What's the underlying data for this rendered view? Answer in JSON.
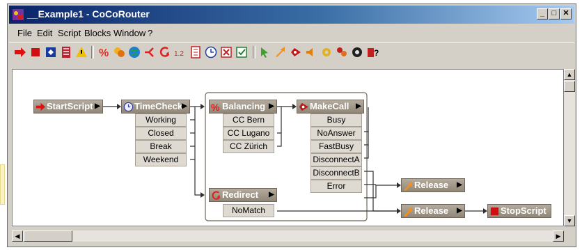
{
  "window": {
    "title": "__Example1 - CoCoRouter",
    "controls": [
      "_",
      "□",
      "✕"
    ]
  },
  "menu": [
    "File",
    "Edit",
    "Script",
    "Blocks",
    "Window",
    "?"
  ],
  "toolbar_icons": [
    "run-icon",
    "stop-icon",
    "debug-icon",
    "variables-icon",
    "warning-icon",
    "percent-icon",
    "group-icon",
    "globe-icon",
    "branch-icon",
    "redirect-icon",
    "counter-icon",
    "document-icon",
    "clock-icon",
    "exit-icon",
    "checkbox-icon",
    "cursor-icon",
    "release-icon",
    "call-icon",
    "speaker-icon",
    "settings-icon",
    "agents-icon",
    "monitor-icon",
    "help-icon"
  ],
  "blocks": {
    "startscript": {
      "label": "StartScript"
    },
    "timecheck": {
      "label": "TimeCheck",
      "outputs": [
        "Working",
        "Closed",
        "Break",
        "Weekend"
      ]
    },
    "balancing": {
      "label": "Balancing",
      "outputs": [
        "CC Bern",
        "CC Lugano",
        "CC Zürich"
      ]
    },
    "redirect": {
      "label": "Redirect",
      "outputs": [
        "NoMatch"
      ]
    },
    "makecall": {
      "label": "MakeCall",
      "outputs": [
        "Busy",
        "NoAnswer",
        "FastBusy",
        "DisconnectA",
        "DisconnectB",
        "Error"
      ]
    },
    "release1": {
      "label": "Release"
    },
    "release2": {
      "label": "Release"
    },
    "stopscript": {
      "label": "StopScript"
    }
  },
  "colors": {
    "title_start": "#0a246a",
    "title_end": "#a6caf0",
    "block_head": "#a39a8c",
    "block_output": "#ded9d1",
    "icon_red": "#cc1010"
  }
}
